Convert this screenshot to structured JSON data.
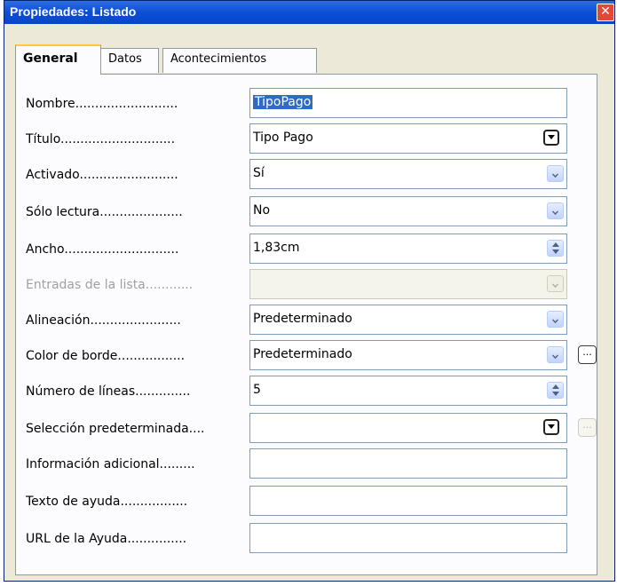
{
  "window": {
    "title": "Propiedades: Listado",
    "close_label": "✕"
  },
  "tabs": [
    {
      "label": "General"
    },
    {
      "label": "Datos"
    },
    {
      "label": "Acontecimientos"
    }
  ],
  "fields": {
    "nombre": {
      "label": "Nombre..........................",
      "value": "TipoPago"
    },
    "titulo": {
      "label": "Título.............................",
      "value": "Tipo Pago"
    },
    "activado": {
      "label": "Activado.........................",
      "value": "Sí"
    },
    "solo_lectura": {
      "label": "Sólo lectura.....................",
      "value": "No"
    },
    "ancho": {
      "label": "Ancho.............................",
      "value": "1,83cm"
    },
    "entradas": {
      "label": "Entradas de la lista............",
      "value": ""
    },
    "alineacion": {
      "label": "Alineación.......................",
      "value": "Predeterminado"
    },
    "color_borde": {
      "label": "Color de borde.................",
      "value": "Predeterminado"
    },
    "num_lineas": {
      "label": "Número de líneas..............",
      "value": "5"
    },
    "seleccion": {
      "label": "Selección predeterminada....",
      "value": ""
    },
    "info_adicional": {
      "label": "Información adicional.........",
      "value": ""
    },
    "texto_ayuda": {
      "label": "Texto de ayuda.................",
      "value": ""
    },
    "url_ayuda": {
      "label": "URL de la Ayuda...............",
      "value": ""
    }
  },
  "buttons": {
    "ellipsis": "..."
  }
}
